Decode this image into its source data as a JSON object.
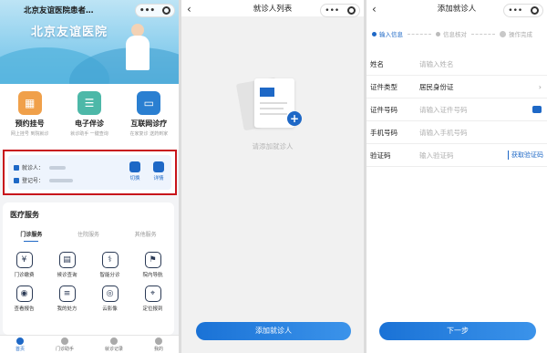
{
  "panel1": {
    "header_title": "北京友谊医院患者…",
    "banner_title": "北京友谊医院",
    "quick_entries": [
      {
        "title": "预约挂号",
        "subtitle": "网上挂号 到院就诊",
        "icon": "calendar-icon",
        "color": "#f0a04a"
      },
      {
        "title": "电子伴诊",
        "subtitle": "就诊助手 一键查询",
        "icon": "companion-icon",
        "color": "#4db8a8"
      },
      {
        "title": "互联网诊疗",
        "subtitle": "在家复诊 送药到家",
        "icon": "monitor-icon",
        "color": "#2a7fd1"
      }
    ],
    "patient_card": {
      "patient_label": "就诊人：",
      "registration_label": "登记号：",
      "switch_label": "切换",
      "detail_label": "详情"
    },
    "medical_services": {
      "title": "医疗服务",
      "tabs": [
        "门诊服务",
        "住院服务",
        "其他服务"
      ],
      "items": [
        {
          "label": "门诊缴费",
          "icon": "yuan-icon"
        },
        {
          "label": "候诊查询",
          "icon": "queue-icon"
        },
        {
          "label": "智能分诊",
          "icon": "triage-icon"
        },
        {
          "label": "院内导航",
          "icon": "navigation-icon"
        },
        {
          "label": "查看报告",
          "icon": "report-icon"
        },
        {
          "label": "我的处方",
          "icon": "prescription-icon"
        },
        {
          "label": "云影像",
          "icon": "cloud-imaging-icon"
        },
        {
          "label": "定位报到",
          "icon": "location-icon"
        }
      ]
    },
    "tabbar": [
      "首页",
      "门诊助手",
      "就诊记录",
      "我的"
    ]
  },
  "panel2": {
    "header_title": "就诊人列表",
    "empty_text": "请添加就诊人",
    "add_button": "添加就诊人"
  },
  "panel3": {
    "header_title": "添加就诊人",
    "steps": [
      "输入信息",
      "信息核对",
      "操作完成"
    ],
    "form": [
      {
        "label": "姓名",
        "value": "请输入姓名",
        "filled": false
      },
      {
        "label": "证件类型",
        "value": "居民身份证",
        "filled": true
      },
      {
        "label": "证件号码",
        "value": "请输入证件号码",
        "filled": false
      },
      {
        "label": "手机号码",
        "value": "请输入手机号码",
        "filled": false
      },
      {
        "label": "验证码",
        "value": "输入验证码",
        "filled": false
      }
    ],
    "get_code": "获取验证码",
    "next_button": "下一步"
  },
  "colors": {
    "brand": "#1e68c6",
    "highlight": "#c8141b"
  }
}
